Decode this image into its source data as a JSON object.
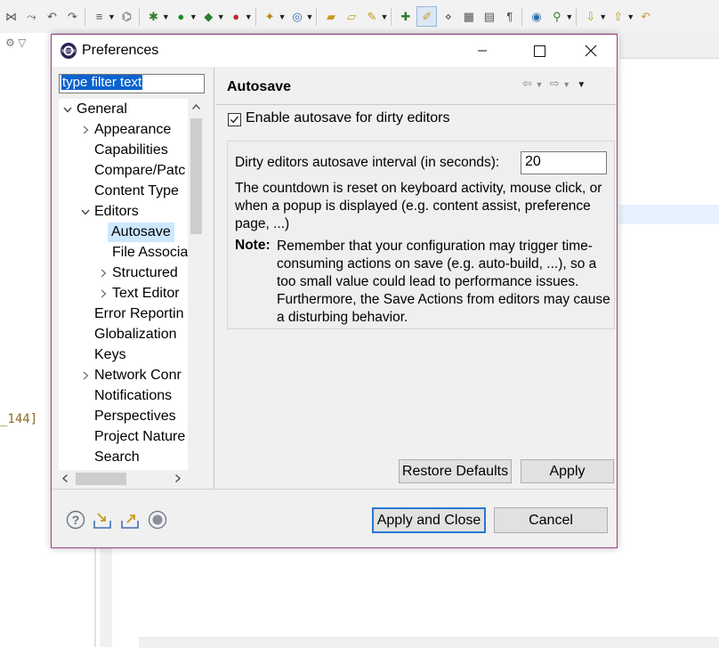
{
  "ide": {
    "code_fragment": "_144]"
  },
  "dialog": {
    "title": "Preferences",
    "filter_placeholder": "type filter text",
    "tree": [
      {
        "label": "General",
        "indent": 0,
        "twisty": "expanded"
      },
      {
        "label": "Appearance",
        "indent": 1,
        "twisty": "collapsed"
      },
      {
        "label": "Capabilities",
        "indent": 1,
        "twisty": "none"
      },
      {
        "label": "Compare/Patc",
        "indent": 1,
        "twisty": "none"
      },
      {
        "label": "Content Type",
        "indent": 1,
        "twisty": "none"
      },
      {
        "label": "Editors",
        "indent": 1,
        "twisty": "expanded"
      },
      {
        "label": "Autosave",
        "indent": 2,
        "twisty": "none",
        "selected": true
      },
      {
        "label": "File Associa",
        "indent": 2,
        "twisty": "none"
      },
      {
        "label": "Structured",
        "indent": 2,
        "twisty": "collapsed"
      },
      {
        "label": "Text Editor",
        "indent": 2,
        "twisty": "collapsed"
      },
      {
        "label": "Error Reportin",
        "indent": 1,
        "twisty": "none"
      },
      {
        "label": "Globalization",
        "indent": 1,
        "twisty": "none"
      },
      {
        "label": "Keys",
        "indent": 1,
        "twisty": "none"
      },
      {
        "label": "Network Conr",
        "indent": 1,
        "twisty": "collapsed"
      },
      {
        "label": "Notifications",
        "indent": 1,
        "twisty": "none"
      },
      {
        "label": "Perspectives",
        "indent": 1,
        "twisty": "none"
      },
      {
        "label": "Project Nature",
        "indent": 1,
        "twisty": "none"
      },
      {
        "label": "Search",
        "indent": 1,
        "twisty": "none"
      }
    ],
    "page": {
      "title": "Autosave",
      "enable_label": "Enable autosave for dirty editors",
      "enable_checked": true,
      "interval_label": "Dirty editors autosave interval (in seconds):",
      "interval_value": "20",
      "countdown_text": "The countdown is reset on keyboard activity, mouse click, or when a popup is displayed (e.g. content assist, preference page, ...)",
      "note_label": "Note:",
      "note_text": "Remember that your configuration may trigger time-consuming actions on save (e.g. auto-build, ...), so a too small value could lead to performance issues. Furthermore, the Save Actions from editors may cause a disturbing behavior."
    },
    "buttons": {
      "restore": "Restore Defaults",
      "apply": "Apply",
      "apply_close": "Apply and Close",
      "cancel": "Cancel"
    },
    "bottom_icons": [
      "help-icon",
      "import-icon",
      "export-icon",
      "record-icon"
    ],
    "colors": {
      "selection": "#0a63cf",
      "tree_selected": "#cce8ff",
      "dialog_border": "#9b3f87",
      "default_button_border": "#2a78d4"
    }
  }
}
